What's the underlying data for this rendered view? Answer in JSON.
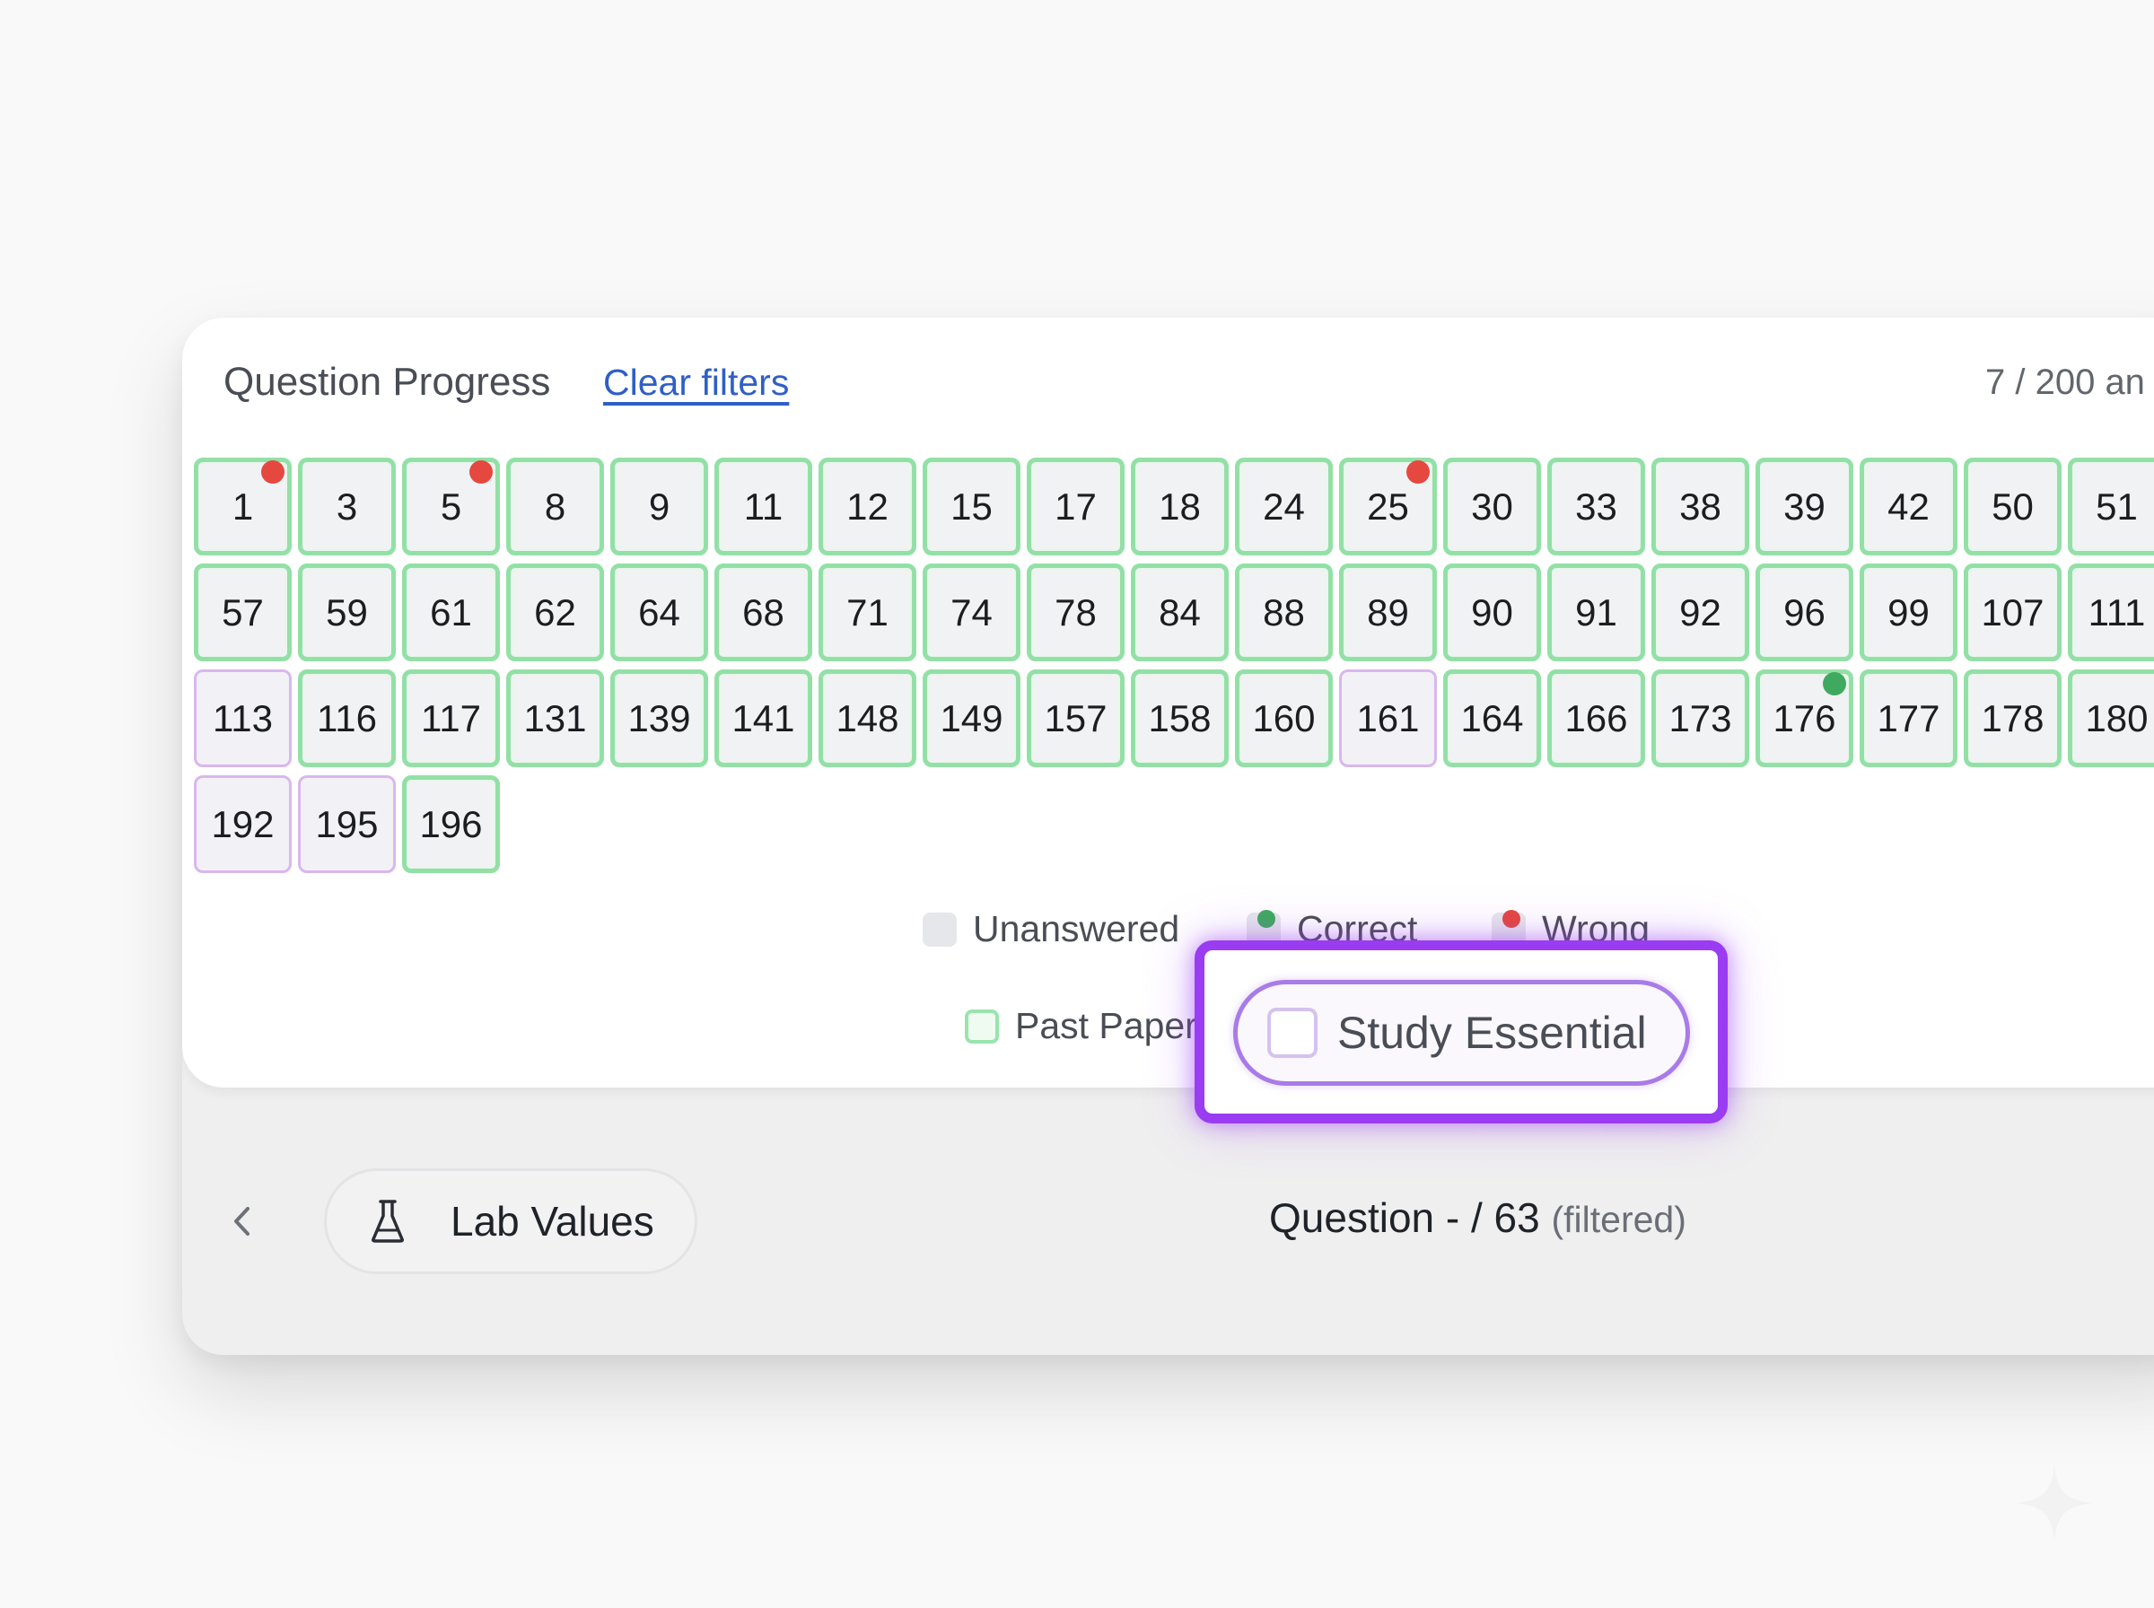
{
  "header": {
    "title": "Question Progress",
    "clear_filters": "Clear filters",
    "answered_count": "7 / 200 an"
  },
  "questions": [
    {
      "number": "1",
      "status": "wrong",
      "category": "past-paper"
    },
    {
      "number": "3",
      "status": "unanswered",
      "category": "past-paper"
    },
    {
      "number": "5",
      "status": "wrong",
      "category": "past-paper"
    },
    {
      "number": "8",
      "status": "unanswered",
      "category": "past-paper"
    },
    {
      "number": "9",
      "status": "unanswered",
      "category": "past-paper"
    },
    {
      "number": "11",
      "status": "unanswered",
      "category": "past-paper"
    },
    {
      "number": "12",
      "status": "unanswered",
      "category": "past-paper"
    },
    {
      "number": "15",
      "status": "unanswered",
      "category": "past-paper"
    },
    {
      "number": "17",
      "status": "unanswered",
      "category": "past-paper"
    },
    {
      "number": "18",
      "status": "unanswered",
      "category": "past-paper"
    },
    {
      "number": "24",
      "status": "unanswered",
      "category": "past-paper"
    },
    {
      "number": "25",
      "status": "wrong",
      "category": "past-paper"
    },
    {
      "number": "30",
      "status": "unanswered",
      "category": "past-paper"
    },
    {
      "number": "33",
      "status": "unanswered",
      "category": "past-paper"
    },
    {
      "number": "38",
      "status": "unanswered",
      "category": "past-paper"
    },
    {
      "number": "39",
      "status": "unanswered",
      "category": "past-paper"
    },
    {
      "number": "42",
      "status": "unanswered",
      "category": "past-paper"
    },
    {
      "number": "50",
      "status": "unanswered",
      "category": "past-paper"
    },
    {
      "number": "51",
      "status": "unanswered",
      "category": "past-paper"
    },
    {
      "number": "57",
      "status": "unanswered",
      "category": "past-paper"
    },
    {
      "number": "59",
      "status": "unanswered",
      "category": "past-paper"
    },
    {
      "number": "61",
      "status": "unanswered",
      "category": "past-paper"
    },
    {
      "number": "62",
      "status": "unanswered",
      "category": "past-paper"
    },
    {
      "number": "64",
      "status": "unanswered",
      "category": "past-paper"
    },
    {
      "number": "68",
      "status": "unanswered",
      "category": "past-paper"
    },
    {
      "number": "71",
      "status": "unanswered",
      "category": "past-paper"
    },
    {
      "number": "74",
      "status": "unanswered",
      "category": "past-paper"
    },
    {
      "number": "78",
      "status": "unanswered",
      "category": "past-paper"
    },
    {
      "number": "84",
      "status": "unanswered",
      "category": "past-paper"
    },
    {
      "number": "88",
      "status": "unanswered",
      "category": "past-paper"
    },
    {
      "number": "89",
      "status": "unanswered",
      "category": "past-paper"
    },
    {
      "number": "90",
      "status": "unanswered",
      "category": "past-paper"
    },
    {
      "number": "91",
      "status": "unanswered",
      "category": "past-paper"
    },
    {
      "number": "92",
      "status": "unanswered",
      "category": "past-paper"
    },
    {
      "number": "96",
      "status": "unanswered",
      "category": "past-paper"
    },
    {
      "number": "99",
      "status": "unanswered",
      "category": "past-paper"
    },
    {
      "number": "107",
      "status": "unanswered",
      "category": "past-paper"
    },
    {
      "number": "111",
      "status": "unanswered",
      "category": "past-paper"
    },
    {
      "number": "113",
      "status": "unanswered",
      "category": "study-essential"
    },
    {
      "number": "116",
      "status": "unanswered",
      "category": "past-paper"
    },
    {
      "number": "117",
      "status": "unanswered",
      "category": "past-paper"
    },
    {
      "number": "131",
      "status": "unanswered",
      "category": "past-paper"
    },
    {
      "number": "139",
      "status": "unanswered",
      "category": "past-paper"
    },
    {
      "number": "141",
      "status": "unanswered",
      "category": "past-paper"
    },
    {
      "number": "148",
      "status": "unanswered",
      "category": "past-paper"
    },
    {
      "number": "149",
      "status": "unanswered",
      "category": "past-paper"
    },
    {
      "number": "157",
      "status": "unanswered",
      "category": "past-paper"
    },
    {
      "number": "158",
      "status": "unanswered",
      "category": "past-paper"
    },
    {
      "number": "160",
      "status": "unanswered",
      "category": "past-paper"
    },
    {
      "number": "161",
      "status": "unanswered",
      "category": "study-essential"
    },
    {
      "number": "164",
      "status": "unanswered",
      "category": "past-paper"
    },
    {
      "number": "166",
      "status": "unanswered",
      "category": "past-paper"
    },
    {
      "number": "173",
      "status": "unanswered",
      "category": "past-paper"
    },
    {
      "number": "176",
      "status": "correct",
      "category": "past-paper"
    },
    {
      "number": "177",
      "status": "unanswered",
      "category": "past-paper"
    },
    {
      "number": "178",
      "status": "unanswered",
      "category": "past-paper"
    },
    {
      "number": "180",
      "status": "unanswered",
      "category": "past-paper"
    },
    {
      "number": "192",
      "status": "unanswered",
      "category": "study-essential"
    },
    {
      "number": "195",
      "status": "unanswered",
      "category": "study-essential"
    },
    {
      "number": "196",
      "status": "unanswered",
      "category": "past-paper"
    }
  ],
  "legend": {
    "unanswered": "Unanswered",
    "correct": "Correct",
    "wrong": "Wrong",
    "past_paper": "Past Paper",
    "study_essential": "Study Essential"
  },
  "footer": {
    "prev_icon": "chevron-left-icon",
    "lab_values": "Lab Values",
    "lab_icon": "flask-icon",
    "question_counter": "Question - / 63",
    "filtered_note": "(filtered)"
  },
  "colors": {
    "past_paper_border": "#93e0a7",
    "study_essential_border": "#d8b7ee",
    "correct_dot": "#3faa5f",
    "wrong_dot": "#e5483f",
    "highlight": "#9a3cf2",
    "link": "#2f5fc6"
  }
}
